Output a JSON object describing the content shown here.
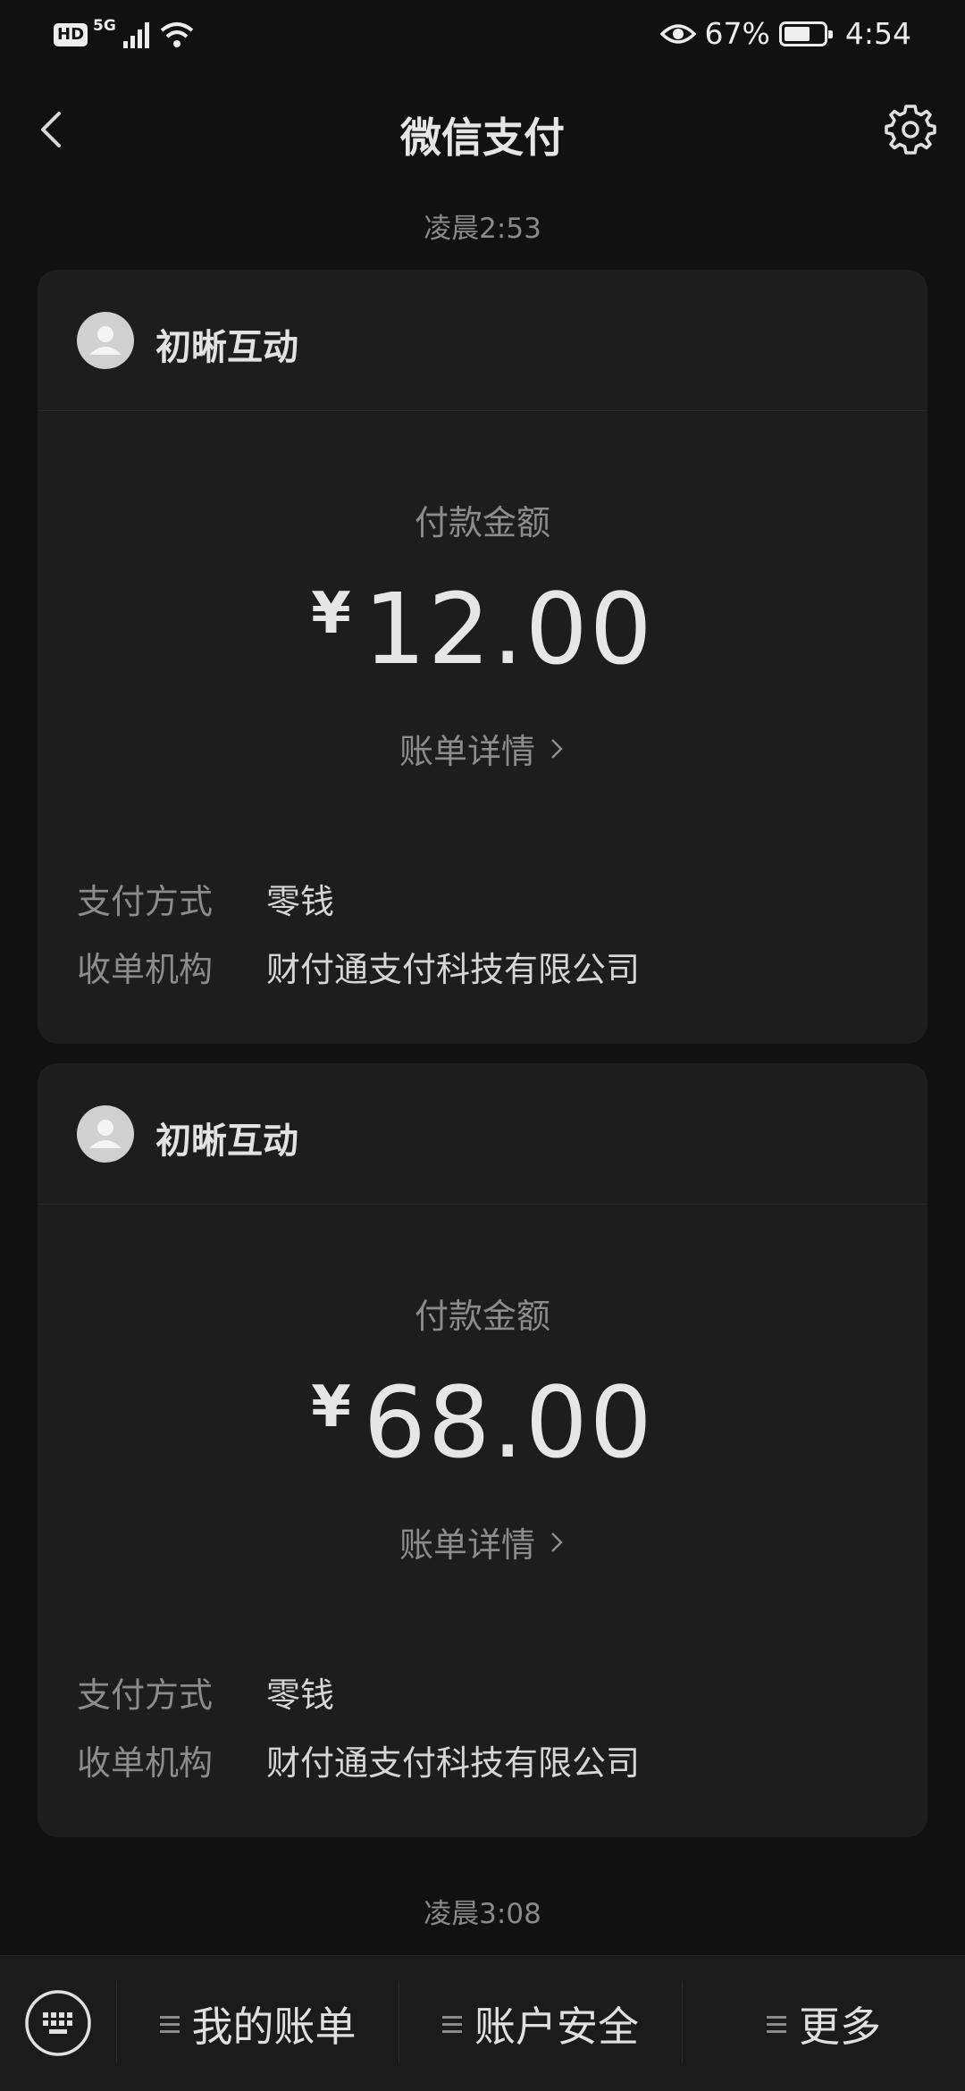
{
  "status_bar": {
    "hd": "HD",
    "network": "5G",
    "battery_percent": "67%",
    "battery_level": 0.67,
    "time": "4:54"
  },
  "header": {
    "title": "微信支付"
  },
  "timestamps": [
    "凌晨2:53",
    "凌晨3:08"
  ],
  "cards": [
    {
      "merchant": "初晰互动",
      "amount_label": "付款金额",
      "currency": "¥",
      "amount": "12.00",
      "bill_detail": "账单详情",
      "payment_method_label": "支付方式",
      "payment_method": "零钱",
      "acquirer_label": "收单机构",
      "acquirer": "财付通支付科技有限公司"
    },
    {
      "merchant": "初晰互动",
      "amount_label": "付款金额",
      "currency": "¥",
      "amount": "68.00",
      "bill_detail": "账单详情",
      "payment_method_label": "支付方式",
      "payment_method": "零钱",
      "acquirer_label": "收单机构",
      "acquirer": "财付通支付科技有限公司"
    }
  ],
  "bottom_menu": {
    "items": [
      "我的账单",
      "账户安全",
      "更多"
    ]
  }
}
